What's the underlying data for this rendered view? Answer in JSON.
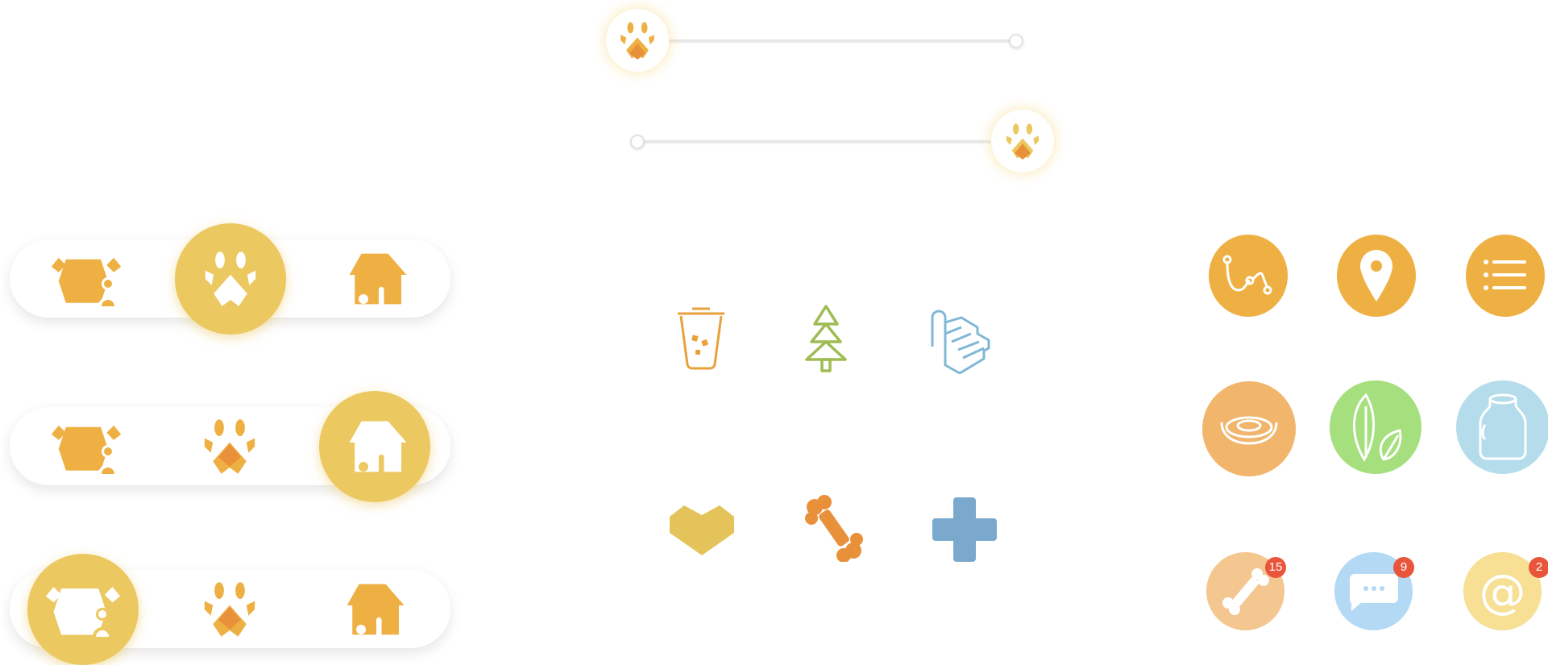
{
  "colors": {
    "accent_yellow": "#ecc860",
    "accent_orange": "#efb043",
    "paw_orange": "#e9913a",
    "green": "#9ebc52",
    "blue": "#7fb7d6",
    "badge_red": "#e8553a"
  },
  "sliders": [
    {
      "name": "slider-top",
      "value": 0,
      "icon": "paw-icon"
    },
    {
      "name": "slider-bottom",
      "value": 1,
      "icon": "paw-icon"
    }
  ],
  "tabbars": [
    {
      "active": "paw",
      "items": [
        "pet-carrier-icon",
        "paw-icon",
        "dog-house-icon"
      ]
    },
    {
      "active": "house",
      "items": [
        "pet-carrier-icon",
        "paw-icon",
        "dog-house-icon"
      ]
    },
    {
      "active": "carrier",
      "items": [
        "pet-carrier-icon",
        "paw-icon",
        "dog-house-icon"
      ]
    }
  ],
  "center_icons": {
    "outline": [
      "litter-bin-icon",
      "tree-icon",
      "cat-stairs-icon"
    ],
    "solid": [
      "heart-icon",
      "bone-icon",
      "plus-icon"
    ]
  },
  "right_icons": {
    "row1": [
      "route-icon",
      "location-pin-icon",
      "list-icon"
    ],
    "row2": [
      "food-bowl-icon",
      "leaves-icon",
      "jar-icon"
    ],
    "row3": [
      "bone-icon",
      "chat-icon",
      "at-icon"
    ]
  },
  "badges": {
    "bone": "15",
    "chat": "9",
    "at": "2"
  }
}
